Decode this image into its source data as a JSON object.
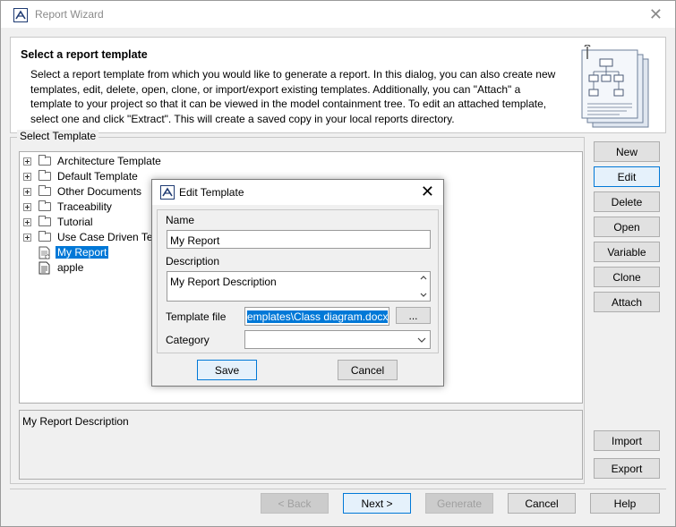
{
  "window": {
    "title": "Report Wizard"
  },
  "header": {
    "title": "Select a report template",
    "description": "Select a report template from which you would like to generate a report. In this dialog, you can also create new templates, edit, delete, open, clone, or import/export existing templates. Additionally, you can \"Attach\" a template to your project so that it can be viewed in the model containment tree. To edit an attached template, select one and click \"Extract\". This will create a saved copy in your local reports directory."
  },
  "template_group": {
    "legend": "Select Template",
    "tree": [
      {
        "label": "Architecture Template",
        "type": "folder"
      },
      {
        "label": "Default Template",
        "type": "folder"
      },
      {
        "label": "Other Documents",
        "type": "folder"
      },
      {
        "label": "Traceability",
        "type": "folder"
      },
      {
        "label": "Tutorial",
        "type": "folder"
      },
      {
        "label": "Use Case Driven Tem",
        "type": "folder"
      },
      {
        "label": "My Report",
        "type": "report",
        "selected": true
      },
      {
        "label": "apple",
        "type": "document"
      }
    ],
    "description": "My Report Description"
  },
  "side_buttons": {
    "new": "New",
    "edit": "Edit",
    "delete": "Delete",
    "open": "Open",
    "variable": "Variable",
    "clone": "Clone",
    "attach": "Attach",
    "import": "Import",
    "export": "Export"
  },
  "bottom_buttons": {
    "back": "< Back",
    "next": "Next >",
    "generate": "Generate",
    "cancel": "Cancel",
    "help": "Help"
  },
  "edit_dialog": {
    "title": "Edit Template",
    "name_label": "Name",
    "name_value": "My Report",
    "description_label": "Description",
    "description_value": "My Report Description",
    "template_file_label": "Template file",
    "template_file_value": "emplates\\Class diagram.docx",
    "browse_label": "...",
    "category_label": "Category",
    "category_value": "",
    "save_label": "Save",
    "cancel_label": "Cancel"
  },
  "colors": {
    "selection": "#0078d7",
    "window_bg": "#f0f0f0",
    "button_bg": "#e1e1e1"
  }
}
